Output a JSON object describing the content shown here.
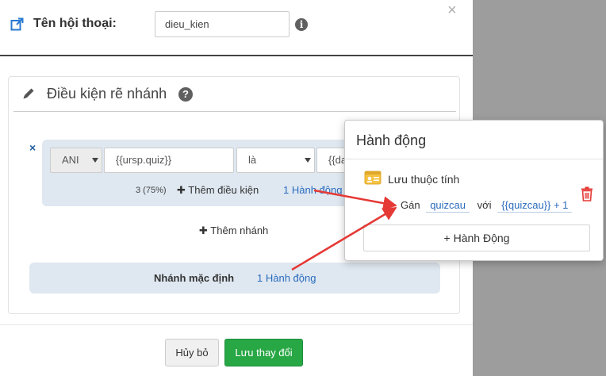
{
  "header": {
    "label": "Tên hội thoại:",
    "name_value": "dieu_kien",
    "close_glyph": "×",
    "info_glyph": "i"
  },
  "panel": {
    "title": "Điều kiện rẽ nhánh",
    "help_glyph": "?"
  },
  "branch": {
    "remove_glyph": "×",
    "logic_operator": "ANI",
    "field_value": "{{ursp.quiz}}",
    "comparison": "là",
    "compare_value": "{{da",
    "match_count": "3 (75%)",
    "add_condition_label": "Thêm điều kiện",
    "action_count_label": "1 Hành động"
  },
  "add_branch_label": "Thêm nhánh",
  "default_branch": {
    "label": "Nhánh mặc định",
    "action_count_label": "1 Hành động"
  },
  "footer": {
    "cancel_label": "Hủy bỏ",
    "save_label": "Lưu thay đổi"
  },
  "popover": {
    "title": "Hành động",
    "action_name": "Lưu thuộc tính",
    "assign_label": "Gán",
    "attribute_token": "quizcau",
    "with_label": "với",
    "value_token": "{{quizcau}} + 1",
    "add_action_label": "+ Hành Động"
  },
  "colors": {
    "accent_link": "#2a6bbd",
    "save_green": "#28a745",
    "delete_red": "#e53935",
    "annotation_arrow": "#e53935",
    "panel_blue": "#dfe8f1",
    "overlay_gray": "#9d9d9d"
  },
  "icons": {
    "header": "external-link-icon",
    "panel": "pencil-icon",
    "action": "id-card-icon",
    "delete": "trash-icon"
  }
}
